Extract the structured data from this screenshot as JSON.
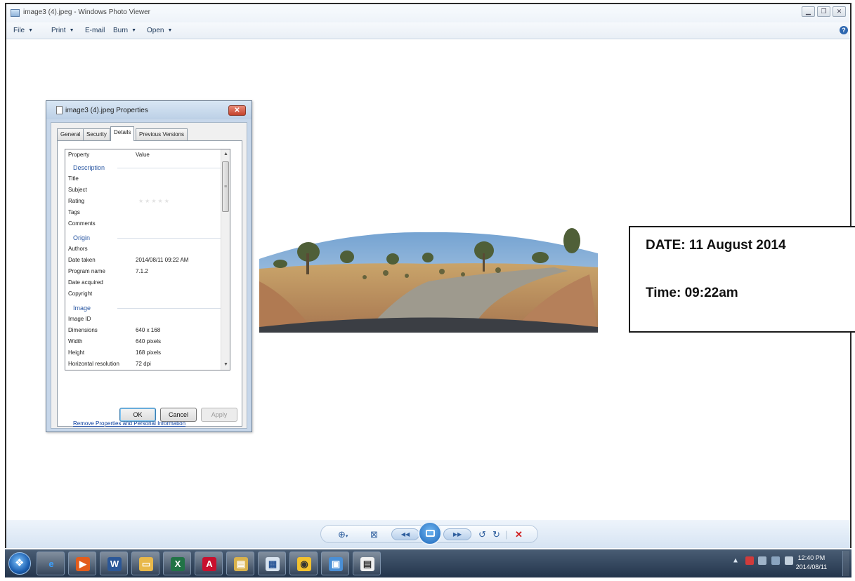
{
  "window": {
    "title": "image3 (4).jpeg - Windows Photo Viewer"
  },
  "menu": {
    "items": [
      {
        "label": "File",
        "has_caret": true
      },
      {
        "label": "Print",
        "has_caret": true
      },
      {
        "label": "E-mail",
        "has_caret": false
      },
      {
        "label": "Burn",
        "has_caret": true
      },
      {
        "label": "Open",
        "has_caret": true
      }
    ],
    "caret_glyph": "▼",
    "help_glyph": "?"
  },
  "dialog": {
    "title": "image3 (4).jpeg Properties",
    "tabs": [
      "General",
      "Security",
      "Details",
      "Previous Versions"
    ],
    "active_tab": "Details",
    "columns": {
      "property": "Property",
      "value": "Value"
    },
    "groups": {
      "description": "Description",
      "origin": "Origin",
      "image": "Image"
    },
    "description_rows": [
      {
        "key": "Title",
        "value": ""
      },
      {
        "key": "Subject",
        "value": ""
      },
      {
        "key": "Rating",
        "value": ""
      },
      {
        "key": "Tags",
        "value": ""
      },
      {
        "key": "Comments",
        "value": ""
      }
    ],
    "origin_rows": [
      {
        "key": "Authors",
        "value": ""
      },
      {
        "key": "Date taken",
        "value": "2014/08/11 09:22 AM"
      },
      {
        "key": "Program name",
        "value": "7.1.2"
      },
      {
        "key": "Date acquired",
        "value": ""
      },
      {
        "key": "Copyright",
        "value": ""
      }
    ],
    "image_rows": [
      {
        "key": "Image ID",
        "value": ""
      },
      {
        "key": "Dimensions",
        "value": "640 x 168"
      },
      {
        "key": "Width",
        "value": "640 pixels"
      },
      {
        "key": "Height",
        "value": "168 pixels"
      },
      {
        "key": "Horizontal resolution",
        "value": "72 dpi"
      }
    ],
    "rating_stars": "★★★★★",
    "remove_link": "Remove Properties and Personal Information",
    "buttons": {
      "ok": "OK",
      "cancel": "Cancel",
      "apply": "Apply"
    }
  },
  "overlay": {
    "date": "DATE: 11 August 2014",
    "time": "Time: 09:22am"
  },
  "taskbar": {
    "clock_time": "12:40 PM",
    "clock_date": "2014/08/11",
    "tray_arrow": "▲"
  },
  "colors": {
    "accent": "#2d67b0",
    "link": "#0b3fa0",
    "group_header": "#2b58a3",
    "taskbar": "#2d3f56"
  }
}
